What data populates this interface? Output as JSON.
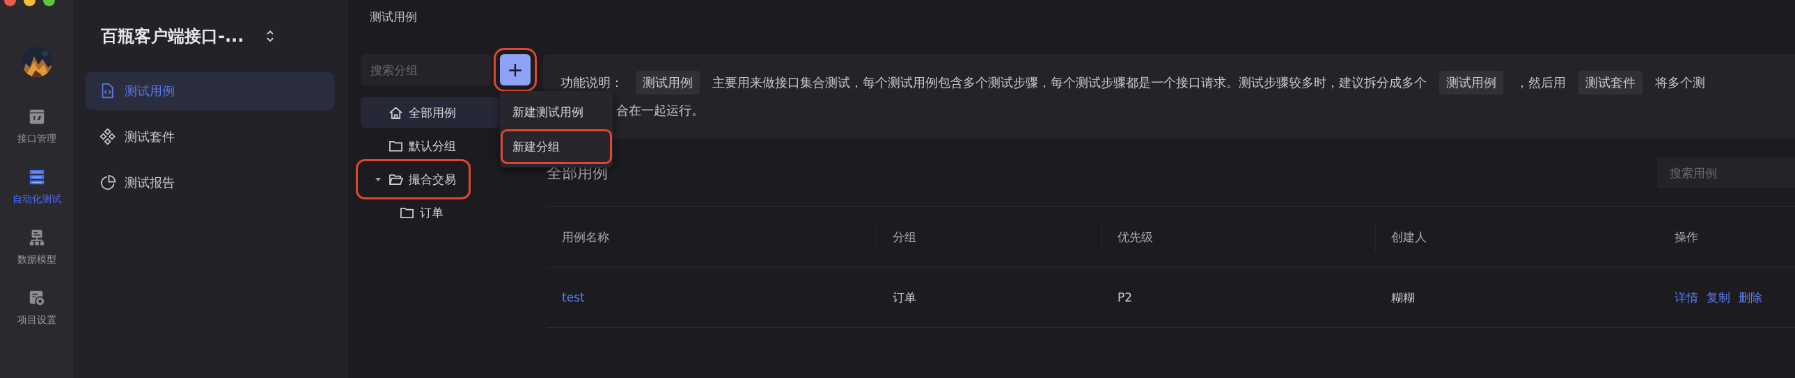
{
  "rail": {
    "items": [
      {
        "label": "接口管理",
        "kind": "api",
        "selected": false
      },
      {
        "label": "自动化测试",
        "kind": "automation",
        "selected": true
      },
      {
        "label": "数据模型",
        "kind": "model",
        "selected": false
      },
      {
        "label": "项目设置",
        "kind": "settings",
        "selected": false
      }
    ]
  },
  "project": {
    "title": "百瓶客户端接口-..."
  },
  "nav": {
    "items": [
      {
        "label": "测试用例",
        "kind": "case",
        "selected": true
      },
      {
        "label": "测试套件",
        "kind": "suite",
        "selected": false
      },
      {
        "label": "测试报告",
        "kind": "report",
        "selected": false
      }
    ]
  },
  "breadcrumb": "测试用例",
  "groups": {
    "placeholder": "搜索分组",
    "add_button": {
      "label": "+",
      "annotated": true
    },
    "tree": [
      {
        "label": "全部用例",
        "kind": "home",
        "selected": true,
        "annotated": false
      },
      {
        "label": "默认分组",
        "kind": "folder",
        "selected": false,
        "annotated": false
      },
      {
        "label": "撮合交易",
        "kind": "folder",
        "selected": false,
        "annotated": true,
        "expanded": true,
        "children": [
          {
            "label": "订单",
            "kind": "folder",
            "selected": false,
            "annotated": false
          }
        ]
      }
    ]
  },
  "add_menu": {
    "items": [
      {
        "label": "新建测试用例",
        "annotated": false
      },
      {
        "label": "新建分组",
        "annotated": true
      }
    ]
  },
  "description": {
    "lines": [
      [
        {
          "kind": "text",
          "text": "功能说明："
        },
        {
          "kind": "tag",
          "text": "测试用例"
        },
        {
          "kind": "text",
          "text": "主要用来做接口集合测试，每个测试用例包含多个测试步骤，每个测试步骤都是一个接口请求。测试步骤较多时，建议拆分成多个"
        },
        {
          "kind": "tag",
          "text": "测试用例"
        },
        {
          "kind": "text",
          "text": "，然后用"
        },
        {
          "kind": "tag",
          "text": "测试套件"
        },
        {
          "kind": "text",
          "text": "将多个测"
        }
      ],
      [
        {
          "kind": "text",
          "text": "合在一起运行。"
        }
      ]
    ]
  },
  "list": {
    "title": "全部用例",
    "placeholder": "搜索用例",
    "columns": [
      "用例名称",
      "分组",
      "优先级",
      "创建人",
      "操作"
    ],
    "rows": [
      {
        "cells": [
          "test",
          "订单",
          "P2",
          "糊糊"
        ],
        "actions": [
          "详情",
          "复制",
          "删除"
        ]
      }
    ]
  }
}
